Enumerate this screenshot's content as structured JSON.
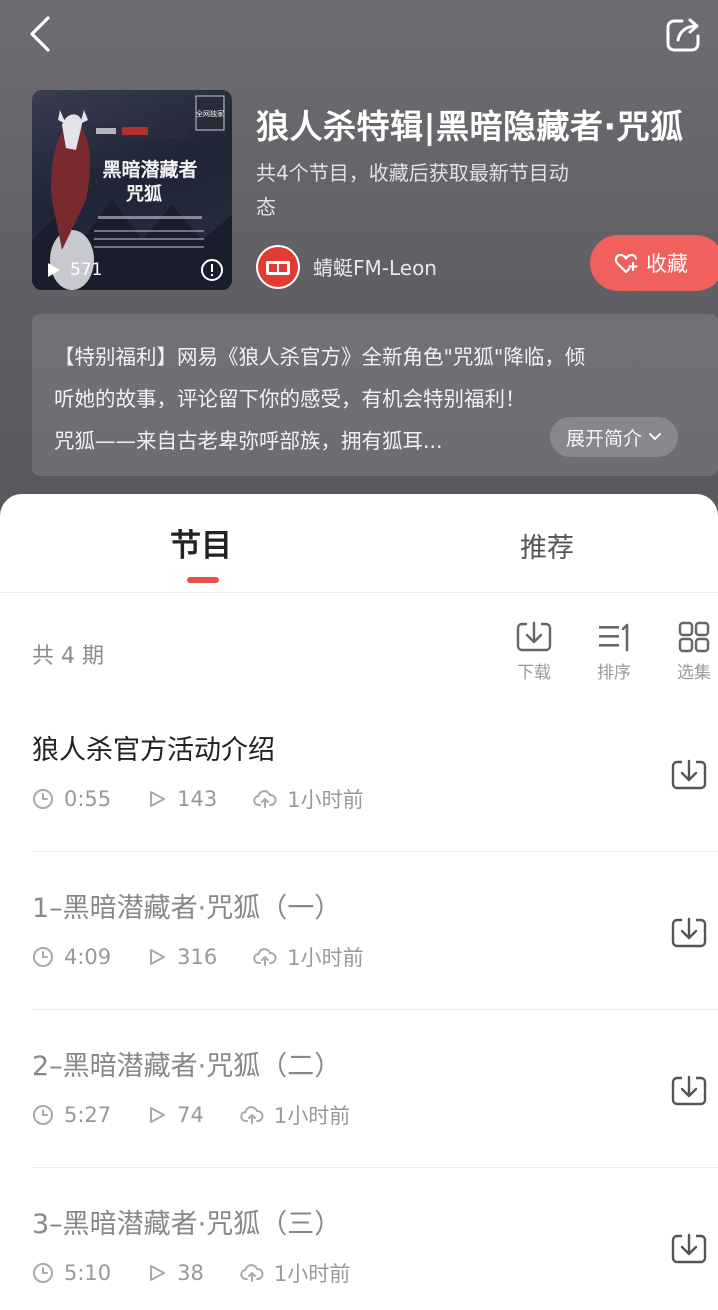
{
  "header": {
    "title": "狼人杀特辑|黑暗隐藏者·咒狐",
    "subtitle": "共4个节目，收藏后获取最新节目动态",
    "play_count": "571",
    "author": "蜻蜓FM-Leon",
    "collect_label": "收藏",
    "description_lines": [
      "【特别福利】网易《狼人杀官方》全新角色\"咒狐\"降临，倾",
      "听她的故事，评论留下你的感受，有机会特别福利！",
      "咒狐——来自古老卑弥呼部族，拥有狐耳..."
    ],
    "expand_label": "展开简介",
    "cover_text": {
      "title": "黑暗潜藏者",
      "name": "咒狐",
      "badge": "全网独家"
    }
  },
  "tabs": [
    {
      "label": "节目",
      "active": true
    },
    {
      "label": "推荐",
      "active": false
    }
  ],
  "list_header": {
    "count": "共 4 期",
    "tools": [
      {
        "label": "下载",
        "icon": "download-icon"
      },
      {
        "label": "排序",
        "icon": "sort-icon"
      },
      {
        "label": "选集",
        "icon": "grid-icon"
      }
    ]
  },
  "episodes": [
    {
      "title": "狼人杀官方活动介绍",
      "duration": "0:55",
      "plays": "143",
      "uploaded": "1小时前",
      "dim": false
    },
    {
      "title": "1–黑暗潜藏者·咒狐（一）",
      "duration": "4:09",
      "plays": "316",
      "uploaded": "1小时前",
      "dim": true
    },
    {
      "title": "2–黑暗潜藏者·咒狐（二）",
      "duration": "5:27",
      "plays": "74",
      "uploaded": "1小时前",
      "dim": true
    },
    {
      "title": "3–黑暗潜藏者·咒狐（三）",
      "duration": "5:10",
      "plays": "38",
      "uploaded": "1小时前",
      "dim": true
    }
  ],
  "colors": {
    "accent": "#f0605c",
    "indicator": "#e8504e",
    "header_bg": "#5f5f64"
  }
}
